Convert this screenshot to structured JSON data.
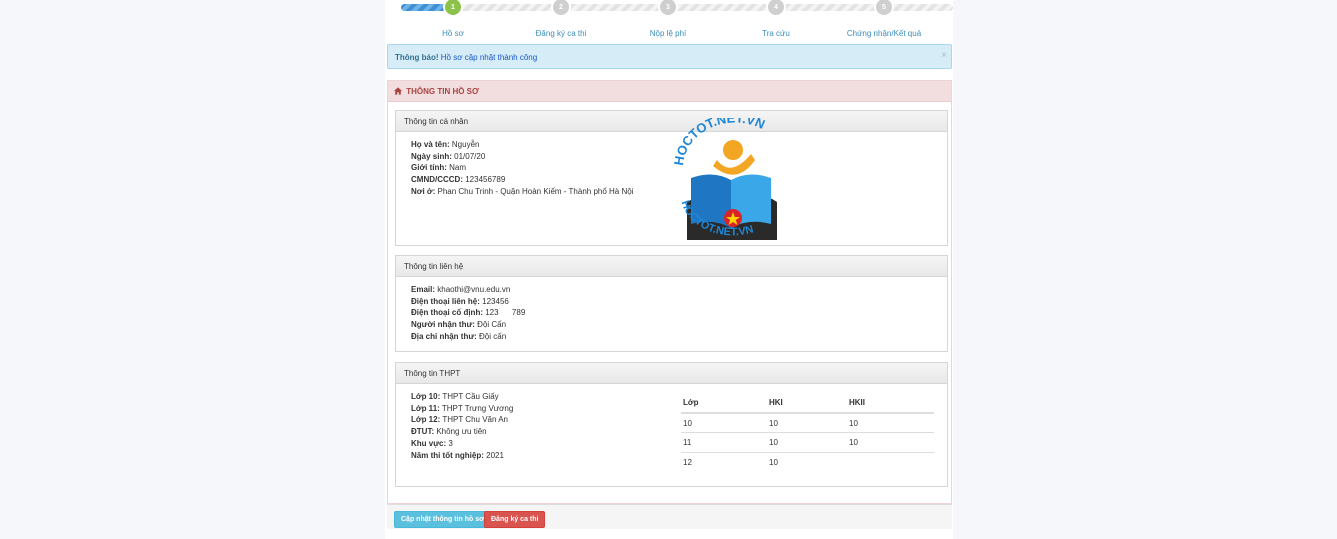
{
  "stepper": {
    "progress_percent": 10,
    "steps": [
      {
        "number": "1",
        "label": "Hồ sơ",
        "active": true
      },
      {
        "number": "2",
        "label": "Đăng ký ca thi",
        "active": false
      },
      {
        "number": "3",
        "label": "Nộp lệ phí",
        "active": false
      },
      {
        "number": "4",
        "label": "Tra cứu",
        "active": false
      },
      {
        "number": "5",
        "label": "Chứng nhận/Kết quả",
        "active": false
      }
    ]
  },
  "alert": {
    "prefix": "Thông báo!",
    "message": "Hồ sơ cập nhật thành công",
    "close": "×"
  },
  "main": {
    "title": "THÔNG TIN HỒ SƠ"
  },
  "personal": {
    "title": "Thông tin cá nhân",
    "rows": [
      {
        "label": "Họ và tên:",
        "value": "Nguyễn"
      },
      {
        "label": "Ngày sinh:",
        "value": "01/07/20"
      },
      {
        "label": "Giới tính:",
        "value": "Nam"
      },
      {
        "label": "CMND/CCCD:",
        "value": "123456789"
      },
      {
        "label": "Nơi ở:",
        "value": "Phan Chu Trinh - Quận Hoàn Kiếm - Thành phố Hà Nội"
      }
    ]
  },
  "contact": {
    "title": "Thông tin liên hệ",
    "rows": [
      {
        "label": "Email:",
        "value": "khaothi@vnu.edu.vn"
      },
      {
        "label": "Điện thoại liên hệ:",
        "value": "123456"
      },
      {
        "label": "Điện thoại cố định:",
        "value": "123      789"
      },
      {
        "label": "Người nhận thư:",
        "value": "Đội Cấn"
      },
      {
        "label": "Địa chỉ nhận thư:",
        "value": "Đội cấn"
      }
    ]
  },
  "highschool": {
    "title": "Thông tin THPT",
    "rows": [
      {
        "label": "Lớp 10:",
        "value": "THPT Cầu Giấy"
      },
      {
        "label": "Lớp 11:",
        "value": "THPT Trưng Vương"
      },
      {
        "label": "Lớp 12:",
        "value": "THPT Chu Văn An"
      },
      {
        "label": "ĐTUT:",
        "value": "Không ưu tiên"
      },
      {
        "label": "Khu vực:",
        "value": "3"
      },
      {
        "label": "Năm thi tốt nghiệp:",
        "value": "2021"
      }
    ],
    "table": {
      "headers": [
        "Lớp",
        "HKI",
        "HKII"
      ],
      "rows": [
        [
          "10",
          "10",
          "10"
        ],
        [
          "11",
          "10",
          "10"
        ],
        [
          "12",
          "10",
          ""
        ]
      ]
    }
  },
  "buttons": {
    "update": "Cập nhật thông tin hồ sơ",
    "register": "Đăng ký ca thi"
  },
  "watermark": {
    "text": "HOCTOT.NET.VN"
  },
  "colors": {
    "active_step": "#8bc34a",
    "link": "#3c8dbc",
    "alert_bg": "#d6edf8",
    "panel_head": "#f2dede",
    "btn_info": "#5bc0de",
    "btn_danger": "#d9534f"
  }
}
